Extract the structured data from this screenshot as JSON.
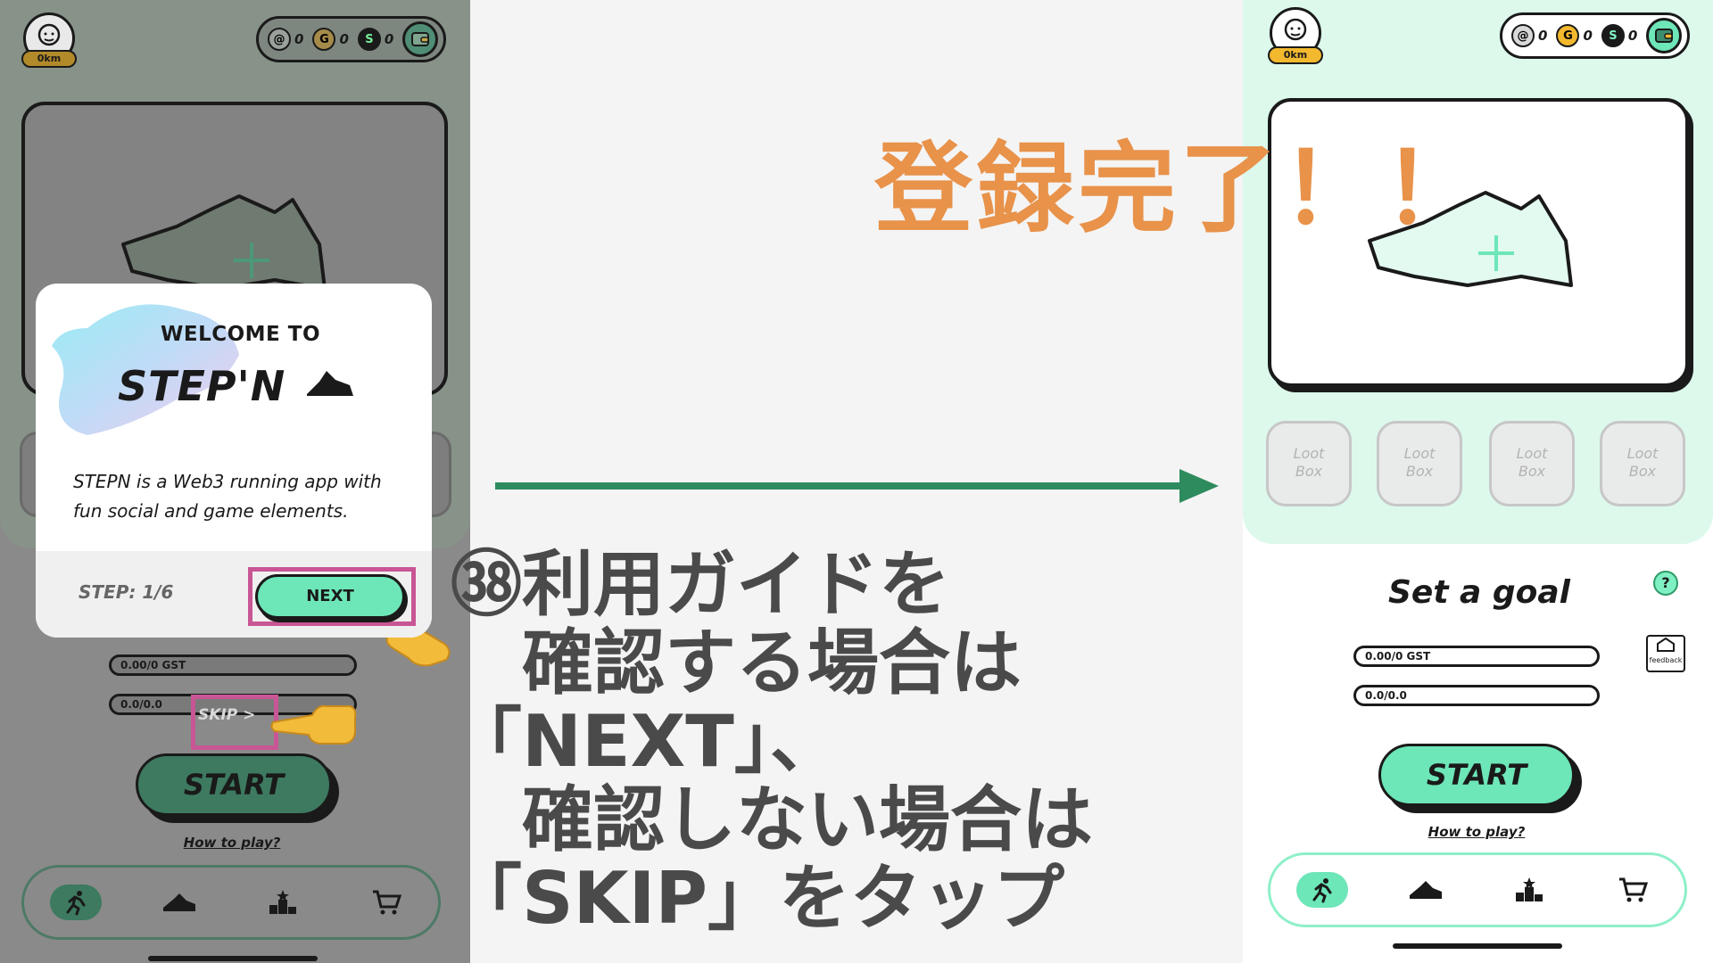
{
  "left_phone": {
    "distance": "0km",
    "wallet": [
      {
        "icon": "gmt-coin-icon",
        "value": "0"
      },
      {
        "icon": "gst-coin-icon",
        "value": "0"
      },
      {
        "icon": "sol-coin-icon",
        "value": "0"
      }
    ],
    "energy_bar": "0.00/0 GST",
    "durability_bar": "0.0/0.0",
    "skip_label": "SKIP >",
    "start_label": "START",
    "how_to_play": "How to play?",
    "modal": {
      "welcome": "WELCOME TO",
      "brand": "STEP'N",
      "description": "STEPN is a Web3 running app with fun social and game elements.",
      "step": "STEP: 1/6",
      "next": "NEXT"
    }
  },
  "right_phone": {
    "distance": "0km",
    "wallet": [
      {
        "icon": "gmt-coin-icon",
        "value": "0"
      },
      {
        "icon": "gst-coin-icon",
        "value": "0"
      },
      {
        "icon": "sol-coin-icon",
        "value": "0"
      }
    ],
    "loot_boxes": [
      "Loot\nBox",
      "Loot\nBox",
      "Loot\nBox",
      "Loot\nBox"
    ],
    "goal_title": "Set a goal",
    "help": "?",
    "feedback": "feedback",
    "gst_bar": "0.00/0 GST",
    "energy_bar": "0.0/0.0",
    "start_label": "START",
    "how_to_play": "How to play?"
  },
  "annotation": {
    "title": "登録完了！！",
    "instruction_lines": [
      "㊳利用ガイドを",
      "　確認する場合は",
      "「NEXT」、",
      "　確認しない場合は",
      "「SKIP」をタップ"
    ]
  },
  "colors": {
    "accent_green": "#6de6b8",
    "arrow_green": "#2e8b5e",
    "title_orange": "#e8924a",
    "highlight_pink": "#c85694"
  }
}
